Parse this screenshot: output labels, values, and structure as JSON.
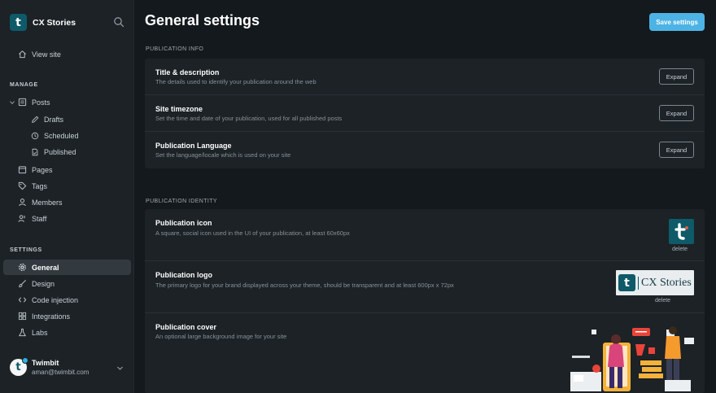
{
  "sidebar": {
    "brand": {
      "name": "CX Stories",
      "logo_letter": "t"
    },
    "search_icon": "search-icon",
    "view_site": "View site",
    "manage_header": "MANAGE",
    "posts": "Posts",
    "drafts": "Drafts",
    "scheduled": "Scheduled",
    "published": "Published",
    "pages": "Pages",
    "tags": "Tags",
    "members": "Members",
    "staff": "Staff",
    "settings_header": "SETTINGS",
    "general": "General",
    "design": "Design",
    "code_injection": "Code injection",
    "integrations": "Integrations",
    "labs": "Labs",
    "user": {
      "name": "Twimbit",
      "email": "aman@twimbit.com"
    }
  },
  "main": {
    "title": "General settings",
    "save_label": "Save settings",
    "publication_info": {
      "label": "PUBLICATION INFO",
      "rows": [
        {
          "title": "Title & description",
          "desc": "The details used to identify your publication around the web",
          "button": "Expand"
        },
        {
          "title": "Site timezone",
          "desc": "Set the time and date of your publication, used for all published posts",
          "button": "Expand"
        },
        {
          "title": "Publication Language",
          "desc": "Set the language/locale which is used on your site",
          "button": "Expand"
        }
      ]
    },
    "publication_identity": {
      "label": "PUBLICATION IDENTITY",
      "icon": {
        "title": "Publication icon",
        "desc": "A square, social icon used in the UI of your publication, at least 60x60px",
        "delete": "delete"
      },
      "logo": {
        "title": "Publication logo",
        "desc": "The primary logo for your brand displayed across your theme, should be transparent and at least 600px x 72px",
        "delete": "delete",
        "logo_text": "CX Stories"
      },
      "cover": {
        "title": "Publication cover",
        "desc": "An optional large background image for your site"
      }
    }
  },
  "colors": {
    "accent": "#4db3e5",
    "brand": "#0e5a68",
    "sidebar_bg": "#1c2226",
    "page_bg": "#14191d"
  }
}
